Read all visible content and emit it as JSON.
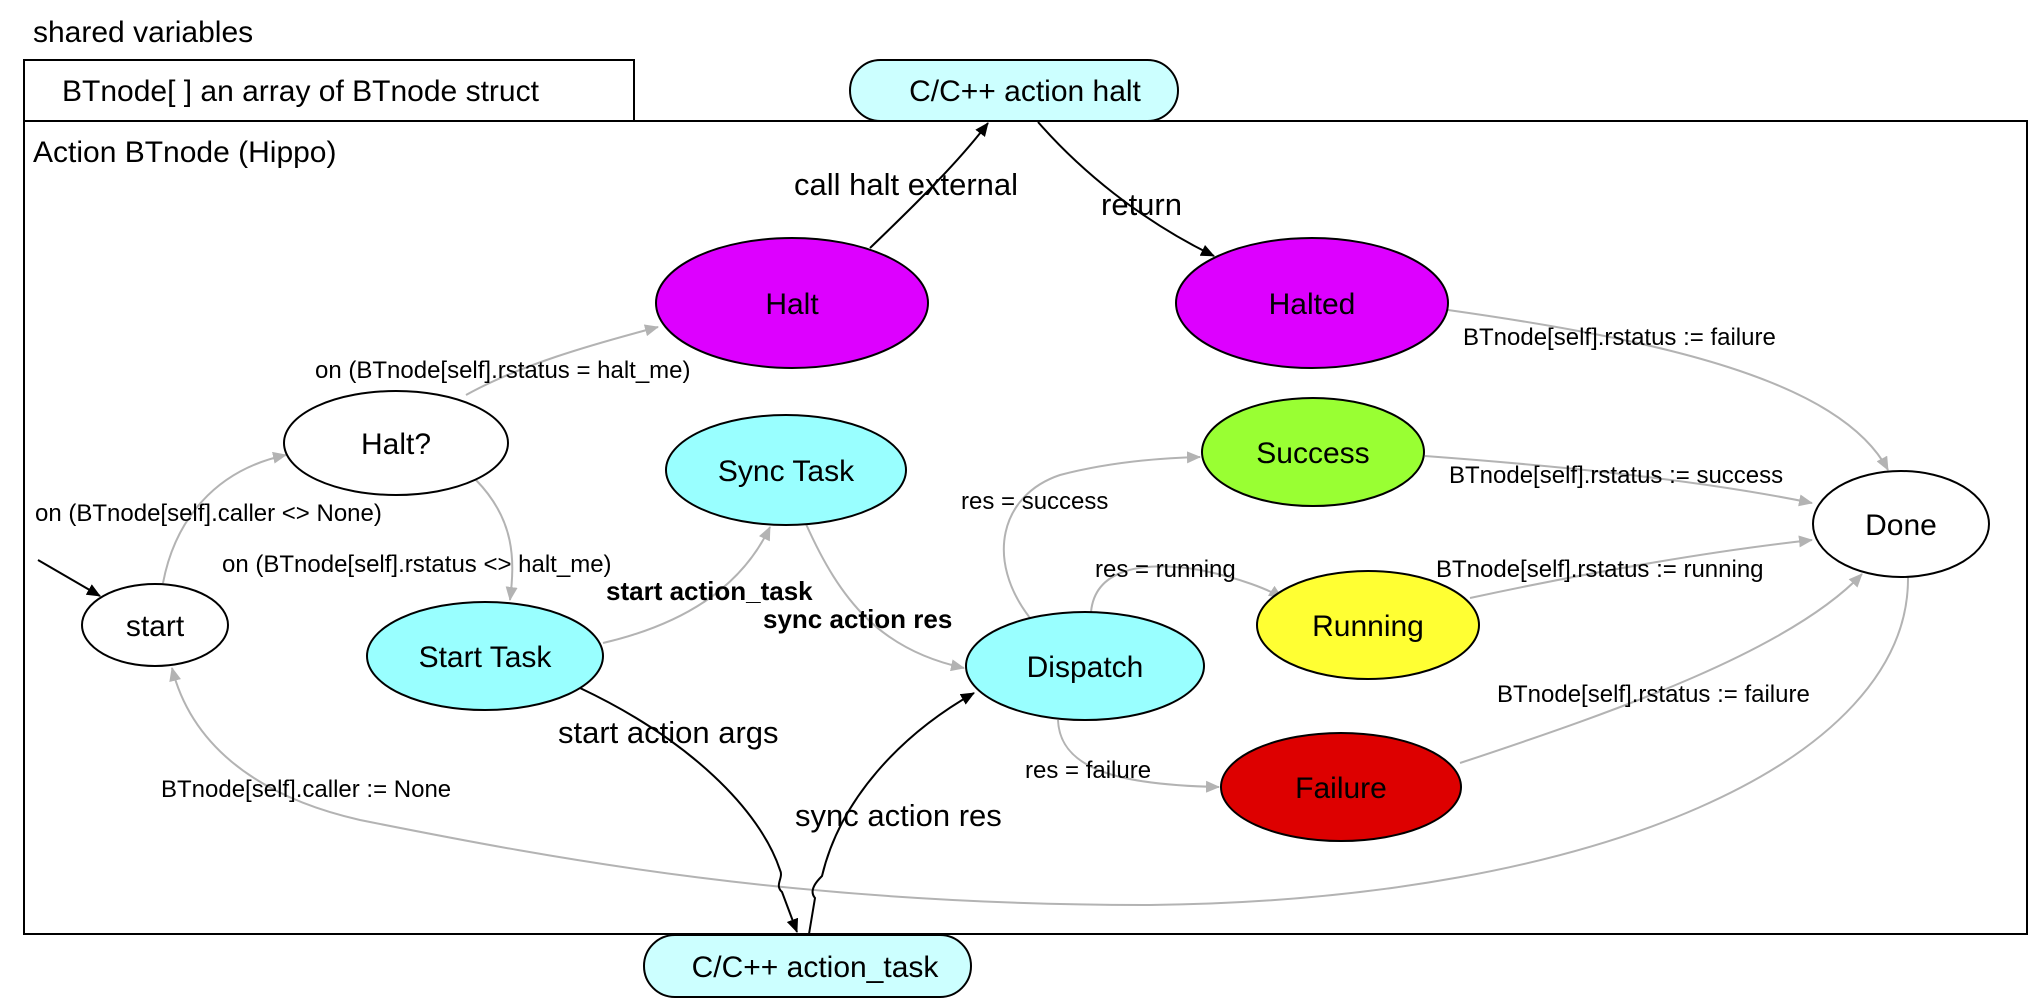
{
  "header": {
    "shared_title": "shared variables",
    "shared_box": "BTnode[ ] an array of BTnode struct",
    "cluster_title": "Action BTnode  (Hippo)"
  },
  "colors": {
    "halt_purple": "#dd00ff",
    "cyan": "#99ffff",
    "external_cyan": "#ccffff",
    "success_green": "#99ff33",
    "running_yellow": "#ffff33",
    "failure_red": "#dd0000",
    "edge_grey": "#b3b3b3"
  },
  "nodes": {
    "start": "start",
    "halt_q": "Halt?",
    "halt": "Halt",
    "halted": "Halted",
    "sync_task": "Sync Task",
    "start_task": "Start Task",
    "dispatch": "Dispatch",
    "success": "Success",
    "running": "Running",
    "failure": "Failure",
    "done": "Done",
    "ext_halt": "C/C++ action halt",
    "ext_task": "C/C++ action_task"
  },
  "edges": {
    "start_to_haltq": "on (BTnode[self].caller <> None)",
    "haltq_to_halt": "on (BTnode[self].rstatus = halt_me)",
    "haltq_to_starttask": "on (BTnode[self].rstatus <> halt_me)",
    "halt_to_ext": "call halt external",
    "ext_to_halted": "return",
    "halted_to_done": "BTnode[self].rstatus := failure",
    "starttask_to_sync": "start action_task",
    "sync_to_dispatch": "sync action res",
    "starttask_to_exttask": "start action args",
    "exttask_to_dispatch": "sync action res",
    "dispatch_to_success": "res = success",
    "dispatch_to_running": "res = running",
    "dispatch_to_failure": "res = failure",
    "success_to_done": "BTnode[self].rstatus := success",
    "running_to_done": "BTnode[self].rstatus := running",
    "failure_to_done": "BTnode[self].rstatus := failure",
    "done_to_start": "BTnode[self].caller := None"
  }
}
